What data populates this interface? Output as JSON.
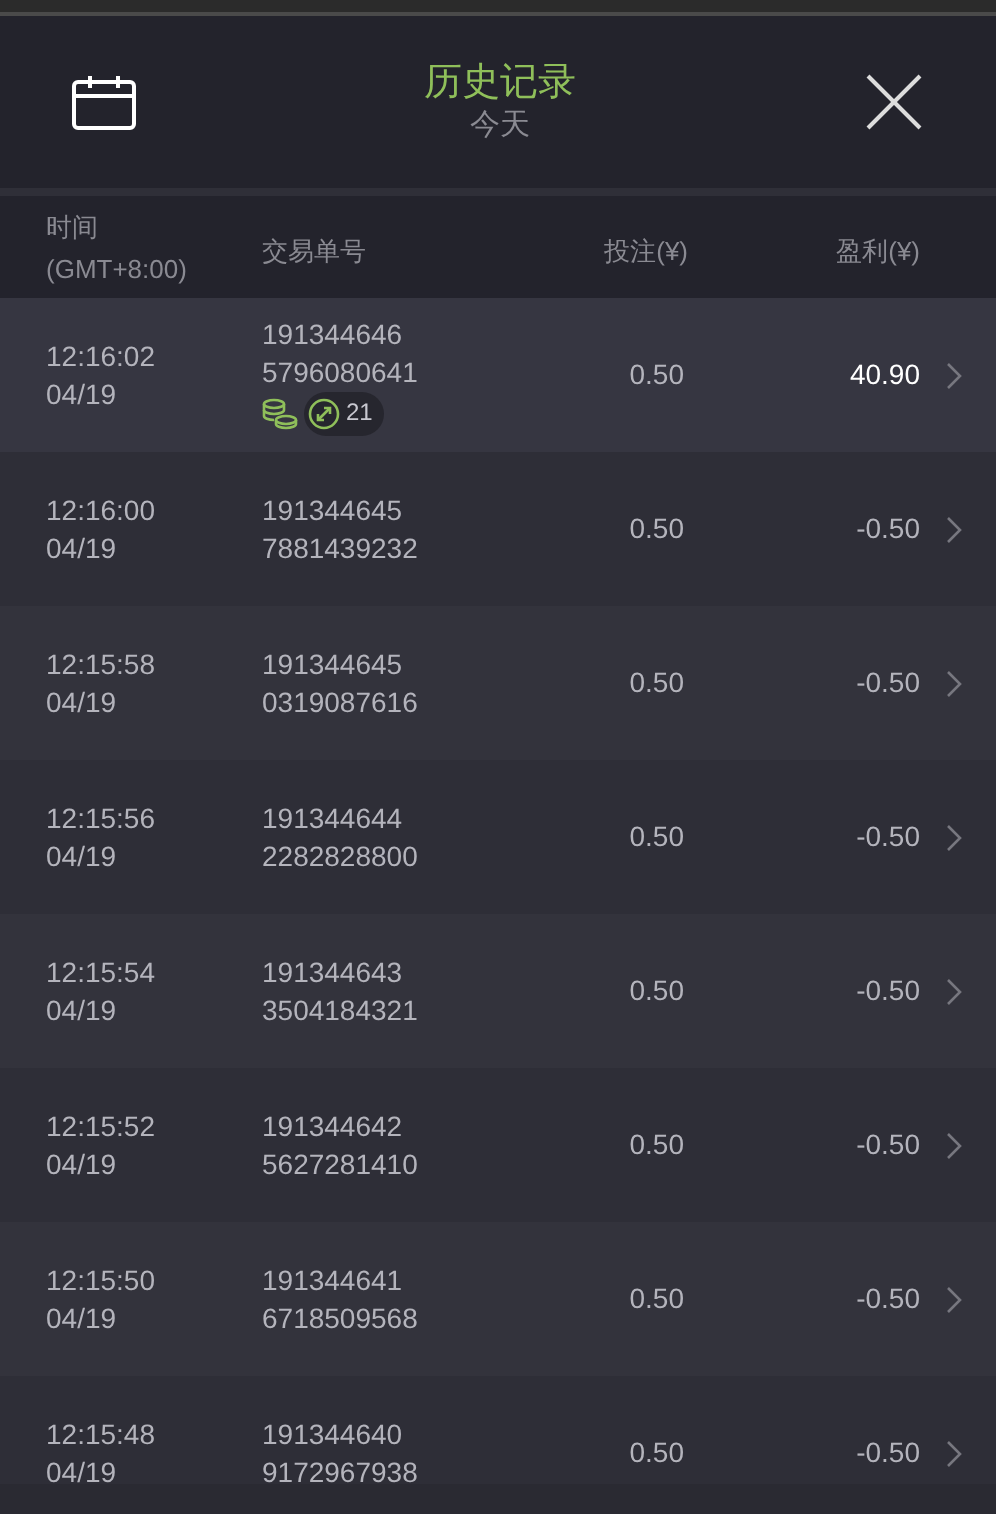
{
  "header": {
    "title": "历史记录",
    "subtitle": "今天"
  },
  "columns": [
    {
      "label": "时间",
      "sub": "(GMT+8:00)"
    },
    {
      "label": "交易单号"
    },
    {
      "label": "投注(¥)"
    },
    {
      "label": "盈利(¥)"
    }
  ],
  "rows": [
    {
      "time": "12:16:02",
      "date": "04/19",
      "id1": "191344646",
      "id2": "5796080641",
      "stake": "0.50",
      "profit": "40.90",
      "win": true,
      "badge": "21"
    },
    {
      "time": "12:16:00",
      "date": "04/19",
      "id1": "191344645",
      "id2": "7881439232",
      "stake": "0.50",
      "profit": "-0.50",
      "win": false
    },
    {
      "time": "12:15:58",
      "date": "04/19",
      "id1": "191344645",
      "id2": "0319087616",
      "stake": "0.50",
      "profit": "-0.50",
      "win": false
    },
    {
      "time": "12:15:56",
      "date": "04/19",
      "id1": "191344644",
      "id2": "2282828800",
      "stake": "0.50",
      "profit": "-0.50",
      "win": false
    },
    {
      "time": "12:15:54",
      "date": "04/19",
      "id1": "191344643",
      "id2": "3504184321",
      "stake": "0.50",
      "profit": "-0.50",
      "win": false
    },
    {
      "time": "12:15:52",
      "date": "04/19",
      "id1": "191344642",
      "id2": "5627281410",
      "stake": "0.50",
      "profit": "-0.50",
      "win": false
    },
    {
      "time": "12:15:50",
      "date": "04/19",
      "id1": "191344641",
      "id2": "6718509568",
      "stake": "0.50",
      "profit": "-0.50",
      "win": false
    },
    {
      "time": "12:15:48",
      "date": "04/19",
      "id1": "191344640",
      "id2": "9172967938",
      "stake": "0.50",
      "profit": "-0.50",
      "win": false
    }
  ]
}
